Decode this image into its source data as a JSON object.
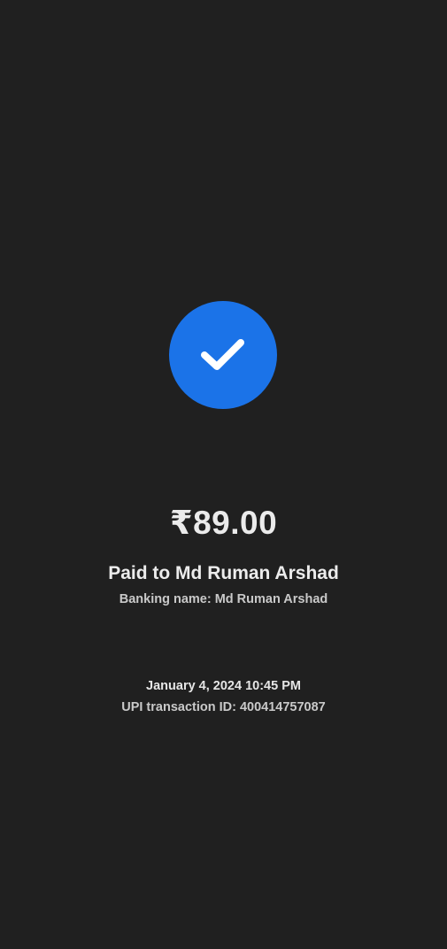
{
  "payment": {
    "status_icon": "checkmark-icon",
    "accent_color": "#1b73e8",
    "amount": "₹89.00",
    "paid_to": "Paid to Md Ruman Arshad",
    "banking_name": "Banking name: Md Ruman Arshad",
    "datetime": "January 4, 2024 10:45 PM",
    "transaction_id": "UPI transaction ID: 400414757087"
  }
}
